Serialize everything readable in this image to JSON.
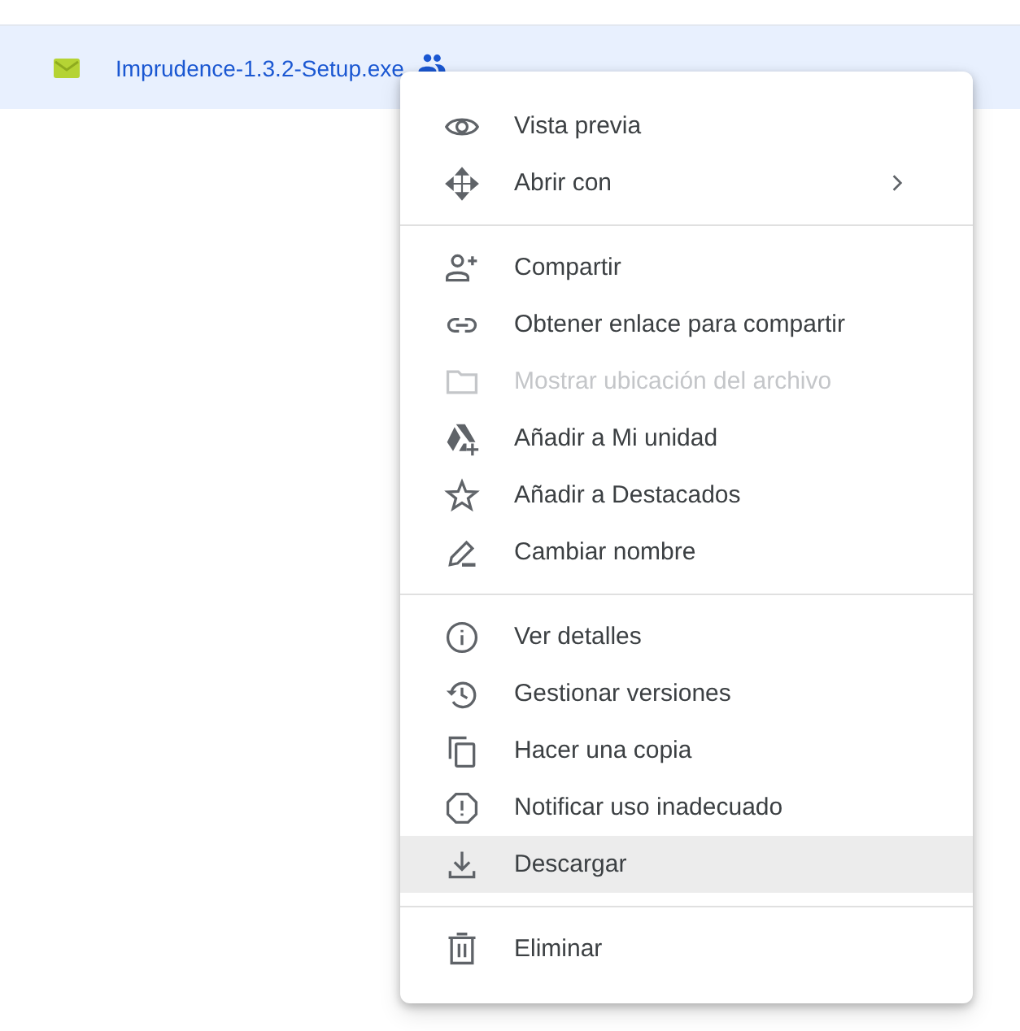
{
  "file_row": {
    "name": "Imprudence-1.3.2-Setup.exe",
    "shared": true,
    "selected": true
  },
  "menu": {
    "groups": [
      {
        "items": [
          {
            "kind": "eye",
            "label": "Vista previa",
            "disabled": false,
            "selected": false,
            "submenu": false
          },
          {
            "kind": "move",
            "label": "Abrir con",
            "disabled": false,
            "selected": false,
            "submenu": true
          }
        ]
      },
      {
        "items": [
          {
            "kind": "person-add",
            "label": "Compartir",
            "disabled": false,
            "selected": false,
            "submenu": false
          },
          {
            "kind": "link",
            "label": "Obtener enlace para compartir",
            "disabled": false,
            "selected": false,
            "submenu": false
          },
          {
            "kind": "folder",
            "label": "Mostrar ubicación del archivo",
            "disabled": true,
            "selected": false,
            "submenu": false
          },
          {
            "kind": "drive-add",
            "label": "Añadir a Mi unidad",
            "disabled": false,
            "selected": false,
            "submenu": false
          },
          {
            "kind": "star",
            "label": "Añadir a Destacados",
            "disabled": false,
            "selected": false,
            "submenu": false
          },
          {
            "kind": "pencil",
            "label": "Cambiar nombre",
            "disabled": false,
            "selected": false,
            "submenu": false
          }
        ]
      },
      {
        "items": [
          {
            "kind": "info",
            "label": "Ver detalles",
            "disabled": false,
            "selected": false,
            "submenu": false
          },
          {
            "kind": "history",
            "label": "Gestionar versiones",
            "disabled": false,
            "selected": false,
            "submenu": false
          },
          {
            "kind": "copy",
            "label": "Hacer una copia",
            "disabled": false,
            "selected": false,
            "submenu": false
          },
          {
            "kind": "alert",
            "label": "Notificar uso inadecuado",
            "disabled": false,
            "selected": false,
            "submenu": false
          },
          {
            "kind": "download",
            "label": "Descargar",
            "disabled": false,
            "selected": true,
            "submenu": false
          }
        ]
      },
      {
        "items": [
          {
            "kind": "trash",
            "label": "Eliminar",
            "disabled": false,
            "selected": false,
            "submenu": false
          }
        ]
      }
    ]
  }
}
